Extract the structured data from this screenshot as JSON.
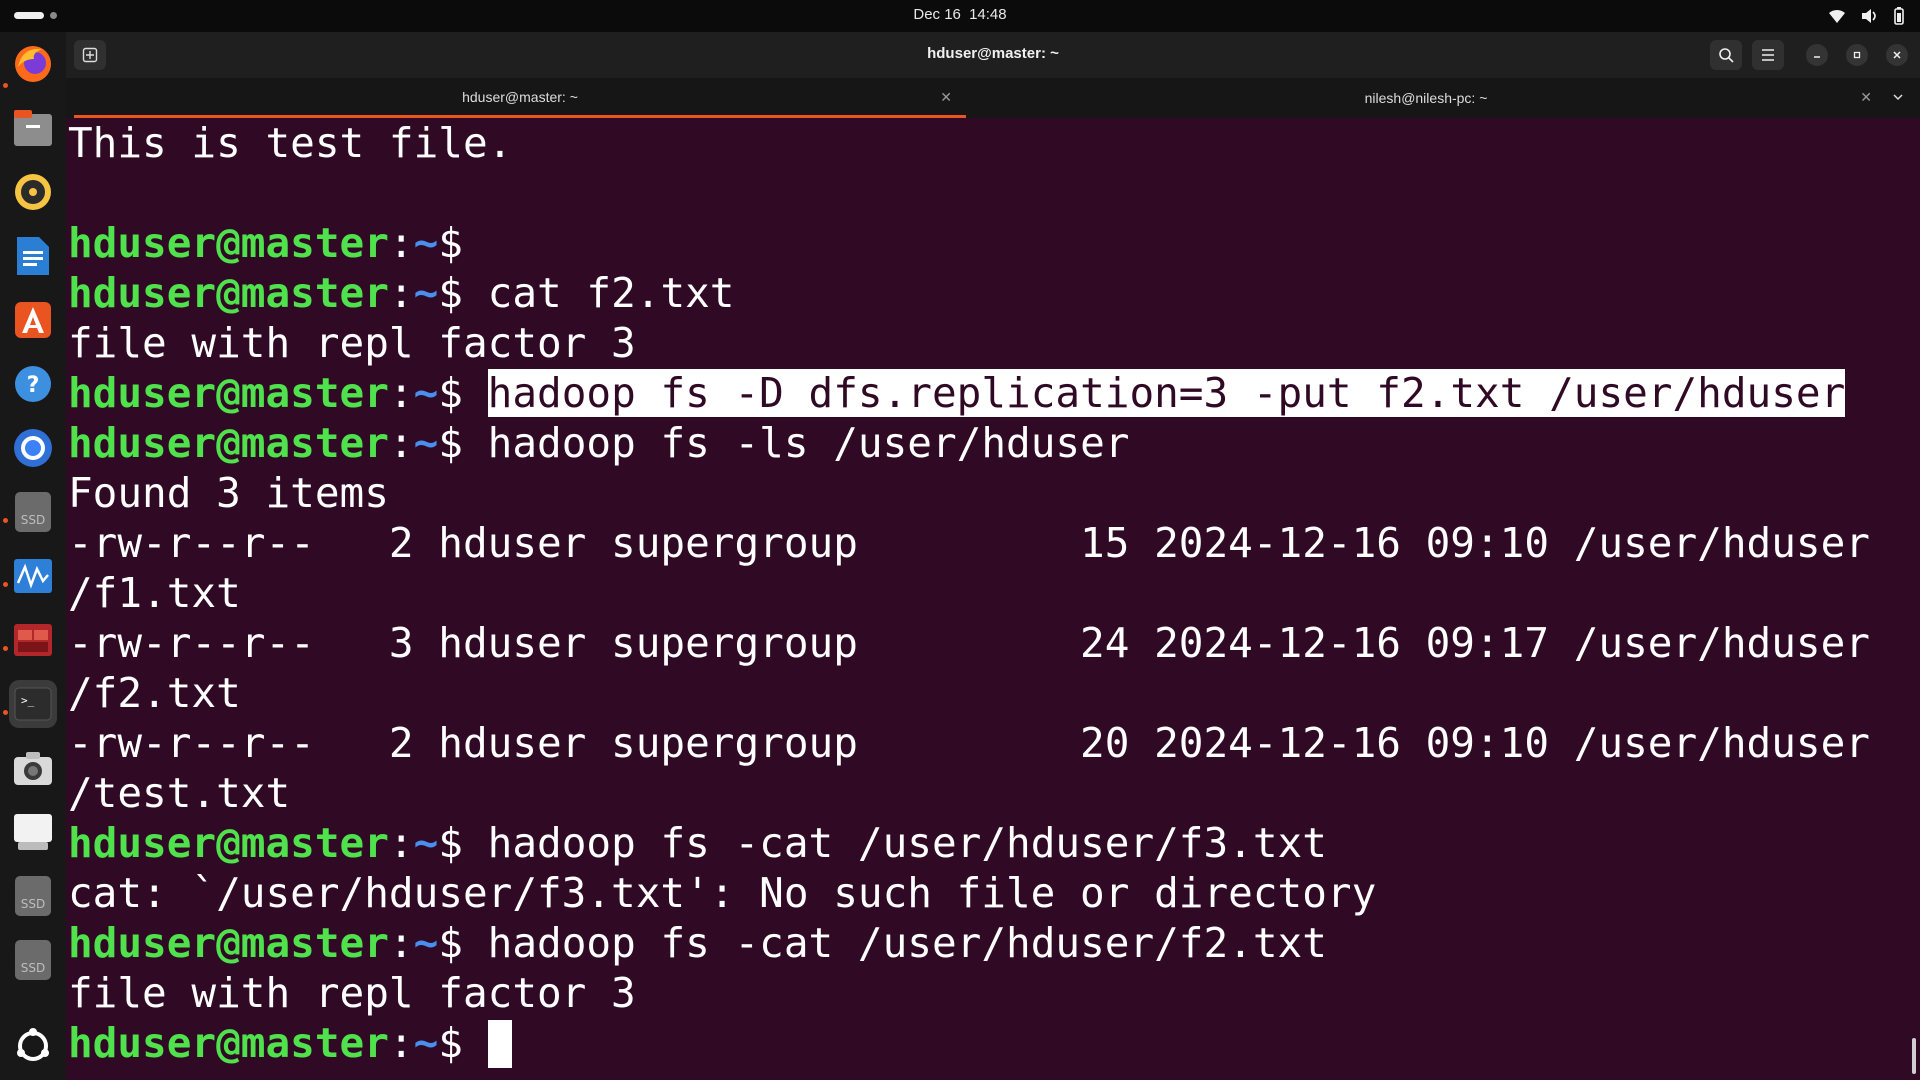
{
  "topbar": {
    "date": "Dec 16",
    "time": "14:48"
  },
  "window": {
    "title": "hduser@master: ~"
  },
  "tabs": [
    {
      "label": "hduser@master: ~"
    },
    {
      "label": "nilesh@nilesh-pc: ~"
    }
  ],
  "dock": {
    "items": [
      "firefox",
      "files",
      "rhythmbox",
      "libreoffice-writer",
      "app-center",
      "help",
      "chromium",
      "ssd-drive",
      "system-monitor",
      "terminal-app-red",
      "terminal",
      "camera",
      "onscreen-keyboard",
      "ssd-drive-2",
      "ssd-drive-3",
      "show-apps"
    ],
    "ssd_label": "SSD"
  },
  "terminal": {
    "prompt_user": "hduser@master",
    "prompt_path": "~",
    "prompt_symbol": "$",
    "lines": [
      {
        "type": "output",
        "text": "This is test file."
      },
      {
        "type": "output",
        "text": ""
      },
      {
        "type": "prompt",
        "cmd": ""
      },
      {
        "type": "prompt",
        "cmd": " cat f2.txt"
      },
      {
        "type": "output",
        "text": "file with repl factor 3"
      },
      {
        "type": "prompt",
        "cmd": "hadoop fs -D dfs.replication=3 -put f2.txt /user/hduser",
        "highlight": true
      },
      {
        "type": "prompt",
        "cmd": " hadoop fs -ls /user/hduser"
      },
      {
        "type": "output",
        "text": "Found 3 items"
      },
      {
        "type": "output",
        "text": "-rw-r--r--   2 hduser supergroup         15 2024-12-16 09:10 /user/hduser"
      },
      {
        "type": "output",
        "text": "/f1.txt"
      },
      {
        "type": "output",
        "text": "-rw-r--r--   3 hduser supergroup         24 2024-12-16 09:17 /user/hduser"
      },
      {
        "type": "output",
        "text": "/f2.txt"
      },
      {
        "type": "output",
        "text": "-rw-r--r--   2 hduser supergroup         20 2024-12-16 09:10 /user/hduser"
      },
      {
        "type": "output",
        "text": "/test.txt"
      },
      {
        "type": "prompt",
        "cmd": " hadoop fs -cat /user/hduser/f3.txt"
      },
      {
        "type": "output",
        "text": "cat: `/user/hduser/f3.txt': No such file or directory"
      },
      {
        "type": "prompt",
        "cmd": " hadoop fs -cat /user/hduser/f2.txt"
      },
      {
        "type": "output",
        "text": "file with repl factor 3"
      },
      {
        "type": "prompt",
        "cmd": " ",
        "cursor": true
      }
    ]
  },
  "colors": {
    "terminal_bg": "#300a24",
    "prompt_user": "#4fe24c",
    "prompt_path": "#4a8ef0",
    "accent": "#e95420"
  }
}
